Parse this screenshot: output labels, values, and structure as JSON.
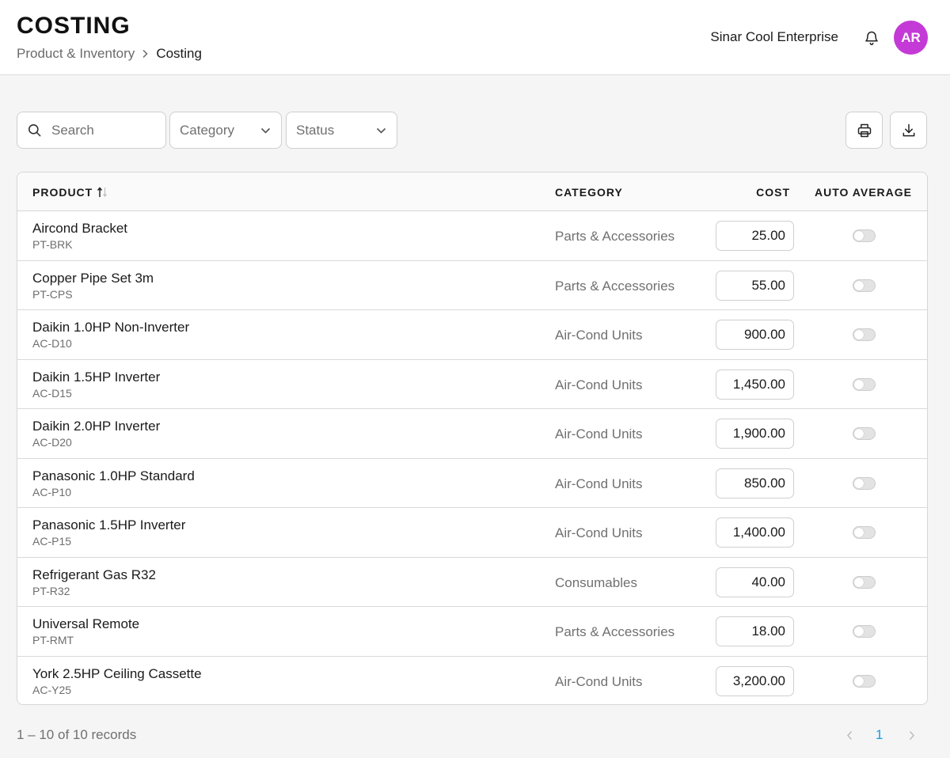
{
  "header": {
    "title": "COSTING",
    "breadcrumb": {
      "parent": "Product & Inventory",
      "current": "Costing"
    },
    "company": "Sinar Cool Enterprise",
    "avatar_initials": "AR",
    "avatar_color": "#c43ad6"
  },
  "toolbar": {
    "search_placeholder": "Search",
    "category_select": "Category",
    "status_select": "Status",
    "print_icon": "print-icon",
    "download_icon": "download-icon"
  },
  "table": {
    "columns": {
      "product": "PRODUCT",
      "category": "CATEGORY",
      "cost": "COST",
      "auto_average": "AUTO AVERAGE"
    },
    "rows": [
      {
        "name": "Aircond Bracket",
        "code": "PT-BRK",
        "category": "Parts & Accessories",
        "cost": "25.00",
        "auto_average": false
      },
      {
        "name": "Copper Pipe Set 3m",
        "code": "PT-CPS",
        "category": "Parts & Accessories",
        "cost": "55.00",
        "auto_average": false
      },
      {
        "name": "Daikin 1.0HP Non-Inverter",
        "code": "AC-D10",
        "category": "Air-Cond Units",
        "cost": "900.00",
        "auto_average": false
      },
      {
        "name": "Daikin 1.5HP Inverter",
        "code": "AC-D15",
        "category": "Air-Cond Units",
        "cost": "1,450.00",
        "auto_average": false
      },
      {
        "name": "Daikin 2.0HP Inverter",
        "code": "AC-D20",
        "category": "Air-Cond Units",
        "cost": "1,900.00",
        "auto_average": false
      },
      {
        "name": "Panasonic 1.0HP Standard",
        "code": "AC-P10",
        "category": "Air-Cond Units",
        "cost": "850.00",
        "auto_average": false
      },
      {
        "name": "Panasonic 1.5HP Inverter",
        "code": "AC-P15",
        "category": "Air-Cond Units",
        "cost": "1,400.00",
        "auto_average": false
      },
      {
        "name": "Refrigerant Gas R32",
        "code": "PT-R32",
        "category": "Consumables",
        "cost": "40.00",
        "auto_average": false
      },
      {
        "name": "Universal Remote",
        "code": "PT-RMT",
        "category": "Parts & Accessories",
        "cost": "18.00",
        "auto_average": false
      },
      {
        "name": "York 2.5HP Ceiling Cassette",
        "code": "AC-Y25",
        "category": "Air-Cond Units",
        "cost": "3,200.00",
        "auto_average": false
      }
    ]
  },
  "footer": {
    "records": "1 – 10 of 10 records",
    "current_page": "1",
    "accent_color": "#1a9be0"
  }
}
